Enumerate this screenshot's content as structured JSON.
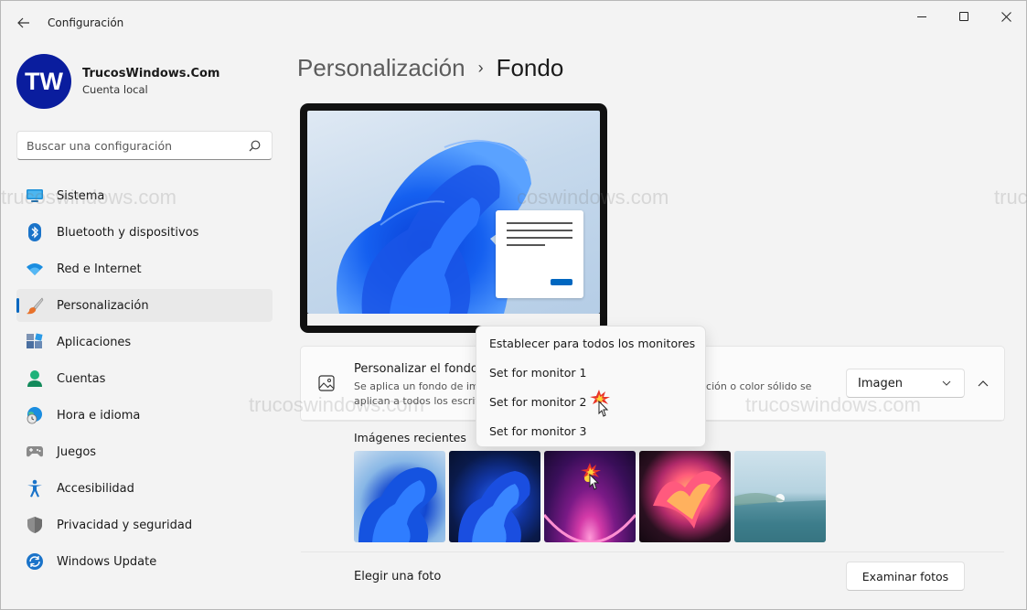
{
  "window": {
    "title": "Configuración"
  },
  "profile": {
    "initials": "TW",
    "name": "TrucosWindows.Com",
    "account_type": "Cuenta local"
  },
  "search": {
    "placeholder": "Buscar una configuración"
  },
  "nav": {
    "items": [
      {
        "label": "Sistema",
        "icon": "monitor-icon"
      },
      {
        "label": "Bluetooth y dispositivos",
        "icon": "bluetooth-icon"
      },
      {
        "label": "Red e Internet",
        "icon": "wifi-icon"
      },
      {
        "label": "Personalización",
        "icon": "brush-icon",
        "active": true
      },
      {
        "label": "Aplicaciones",
        "icon": "apps-icon"
      },
      {
        "label": "Cuentas",
        "icon": "person-icon"
      },
      {
        "label": "Hora e idioma",
        "icon": "globe-clock-icon"
      },
      {
        "label": "Juegos",
        "icon": "gamepad-icon"
      },
      {
        "label": "Accesibilidad",
        "icon": "accessibility-icon"
      },
      {
        "label": "Privacidad y seguridad",
        "icon": "shield-icon"
      },
      {
        "label": "Windows Update",
        "icon": "update-icon"
      }
    ]
  },
  "breadcrumb": {
    "parent": "Personalización",
    "separator": "›",
    "current": "Fondo"
  },
  "background_card": {
    "title": "Personalizar el fondo",
    "description_line1_start": "Se aplica un fondo de im",
    "description_line1_end": "tación o color sólido se",
    "description_line2": "aplican a todos los escrit",
    "select_value": "Imagen",
    "recent_label": "Imágenes recientes",
    "choose_photo_label": "Elegir una foto",
    "browse_button": "Examinar fotos"
  },
  "context_menu": {
    "items": [
      "Establecer para todos los monitores",
      "Set for monitor 1",
      "Set for monitor 2",
      "Set for monitor 3"
    ]
  },
  "watermark": "trucoswindows.com",
  "watermark_short": "trucos",
  "watermark_mid": "coswindows.com",
  "colors": {
    "accent": "#0067c0",
    "avatar": "#0a1d9e",
    "background": "#f3f3f3"
  }
}
